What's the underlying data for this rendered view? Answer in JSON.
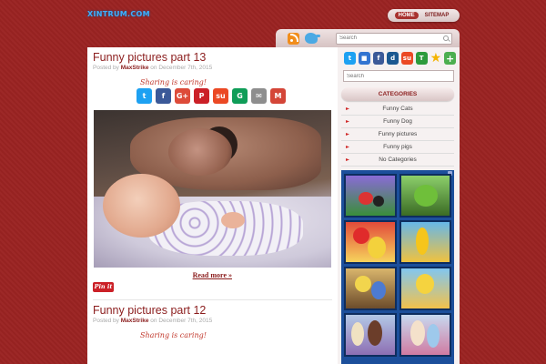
{
  "site": {
    "logo": "XINTRUM.COM"
  },
  "topnav": {
    "items": [
      {
        "label": "HOME"
      },
      {
        "label": "SITEMAP"
      }
    ]
  },
  "header": {
    "search_placeholder": "Search",
    "icons": [
      "rss-icon",
      "twitter-bird-icon",
      "magnifier-icon"
    ]
  },
  "posts": [
    {
      "title": "Funny pictures part 13",
      "posted_by": "Posted by",
      "author": "MaxStrike",
      "on": "on",
      "date": "December 7th, 2015",
      "sharing_label": "Sharing is caring!",
      "share_buttons": [
        {
          "name": "twitter",
          "glyph": "t",
          "color": "#1da1f2"
        },
        {
          "name": "facebook",
          "glyph": "f",
          "color": "#3b5998"
        },
        {
          "name": "google-plus",
          "glyph": "G+",
          "color": "#dd4b39"
        },
        {
          "name": "pinterest",
          "glyph": "P",
          "color": "#cb2027"
        },
        {
          "name": "stumbleupon",
          "glyph": "su",
          "color": "#eb4924"
        },
        {
          "name": "google",
          "glyph": "G",
          "color": "#0f9d58"
        },
        {
          "name": "email",
          "glyph": "✉",
          "color": "#8e8e8e"
        },
        {
          "name": "gmail",
          "glyph": "M",
          "color": "#d44638"
        }
      ],
      "read_more": "Read more »",
      "pin_label": "Pin it"
    },
    {
      "title": "Funny pictures part 12",
      "posted_by": "Posted by",
      "author": "MaxStrike",
      "on": "on",
      "date": "December 7th, 2015",
      "sharing_label": "Sharing is caring!"
    }
  ],
  "sidebar": {
    "social_icons": [
      {
        "name": "twitter",
        "glyph": "t",
        "color": "#1da1f2"
      },
      {
        "name": "delicious",
        "glyph": "■",
        "color": "#3274d1"
      },
      {
        "name": "facebook",
        "glyph": "f",
        "color": "#3b5998"
      },
      {
        "name": "digg",
        "glyph": "d",
        "color": "#1b5891"
      },
      {
        "name": "stumbleupon",
        "glyph": "su",
        "color": "#eb4924"
      },
      {
        "name": "technorati",
        "glyph": "T",
        "color": "#2d9b3c"
      },
      {
        "name": "favorite",
        "glyph": "★",
        "color": "transparent"
      },
      {
        "name": "add",
        "glyph": "+",
        "color": "#4caf50"
      }
    ],
    "search_placeholder": "Search",
    "categories": {
      "title": "CATEGORIES",
      "items": [
        {
          "label": "Funny Cats"
        },
        {
          "label": "Funny Dog"
        },
        {
          "label": "Funny pictures"
        },
        {
          "label": "Funny pigs"
        },
        {
          "label": "No Categories"
        }
      ]
    }
  },
  "colors": {
    "background": "#9b2322",
    "accent": "#8b1d1d",
    "link": "#8b1d1d",
    "ad_panel": "#1c4f9b"
  }
}
